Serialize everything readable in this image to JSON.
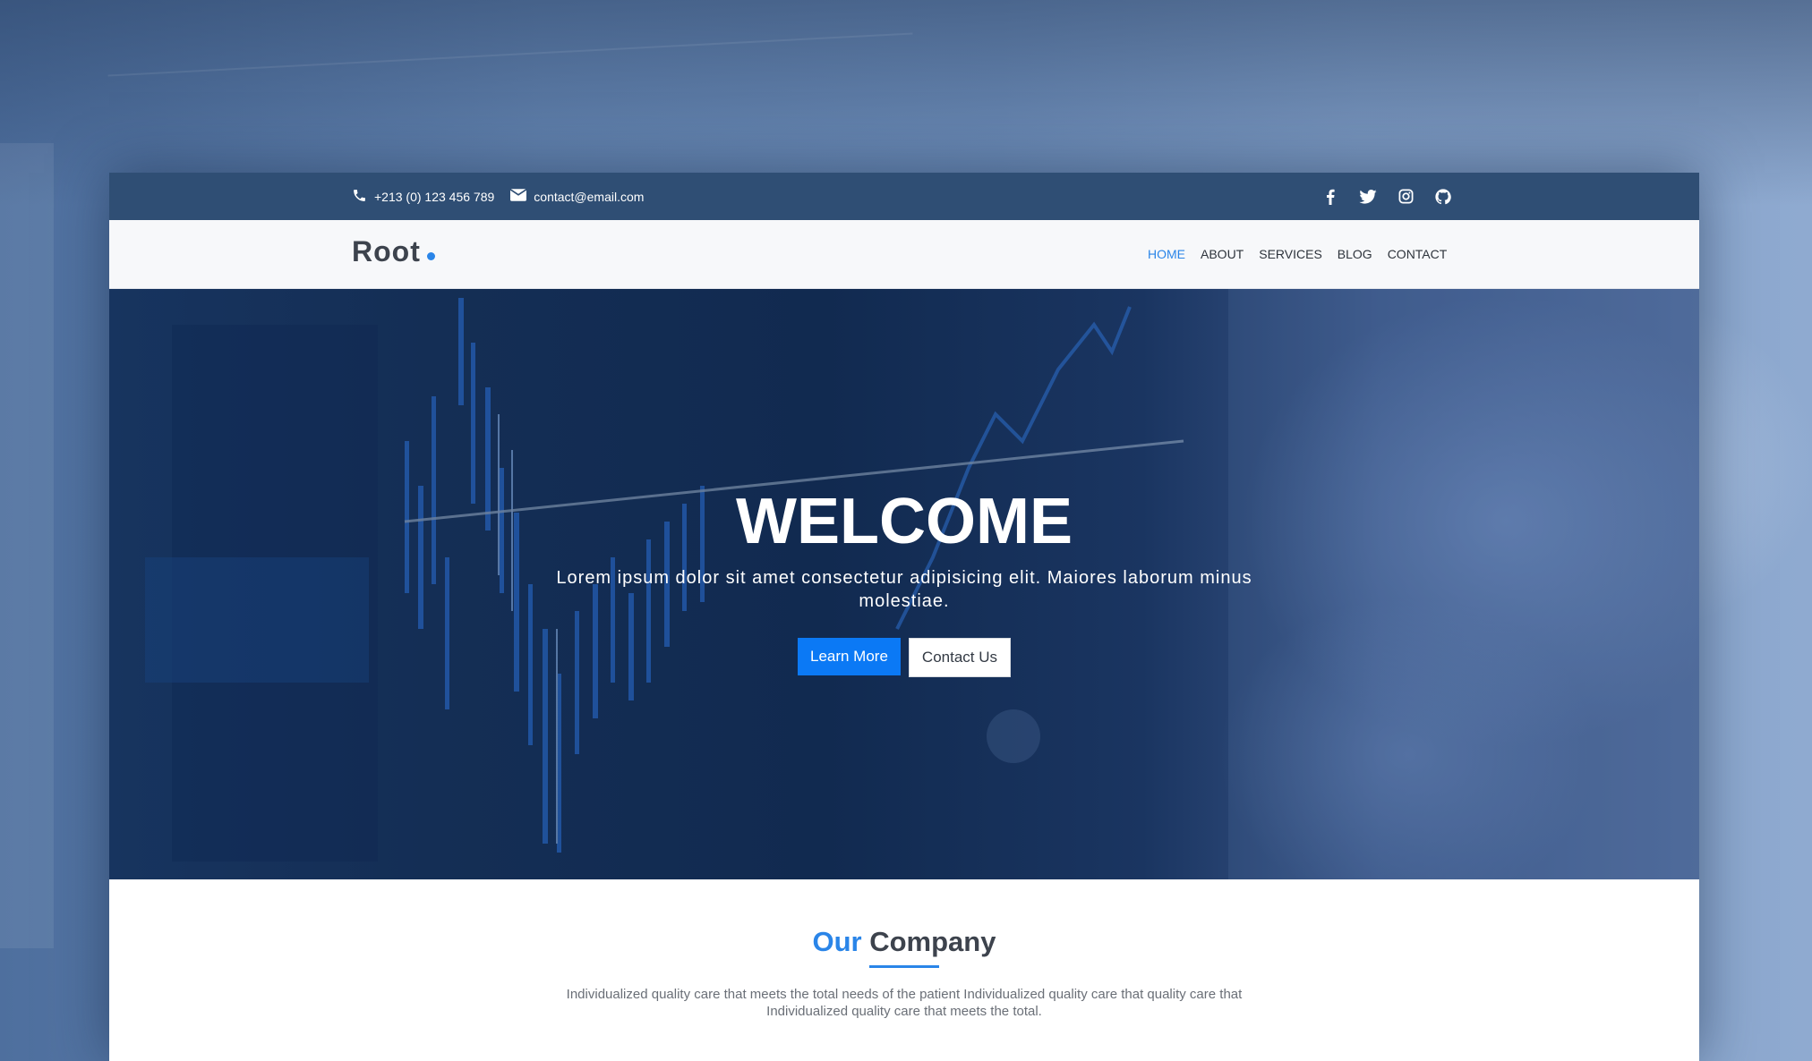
{
  "topbar": {
    "phone": "+213 (0) 123 456 789",
    "email": "contact@email.com",
    "social": [
      "facebook-icon",
      "twitter-icon",
      "instagram-icon",
      "github-icon"
    ]
  },
  "brand": {
    "name": "Root"
  },
  "nav": {
    "items": [
      {
        "label": "HOME",
        "active": true
      },
      {
        "label": "ABOUT"
      },
      {
        "label": "SERVICES"
      },
      {
        "label": "BLOG"
      },
      {
        "label": "CONTACT"
      }
    ]
  },
  "hero": {
    "title": "WELCOME",
    "subtitle": "Lorem ipsum dolor sit amet consectetur adipisicing elit. Maiores laborum minus molestiae.",
    "primary_button": "Learn More",
    "secondary_button": "Contact Us"
  },
  "company": {
    "title_accent": "Our",
    "title_rest": " Company",
    "text": "Individualized quality care that meets the total needs of the patient Individualized quality care that quality care that Individualized quality care that meets the total."
  },
  "colors": {
    "accent": "#2a85e8",
    "topbar": "#2f4e74",
    "primary_button": "#0b79f5"
  }
}
